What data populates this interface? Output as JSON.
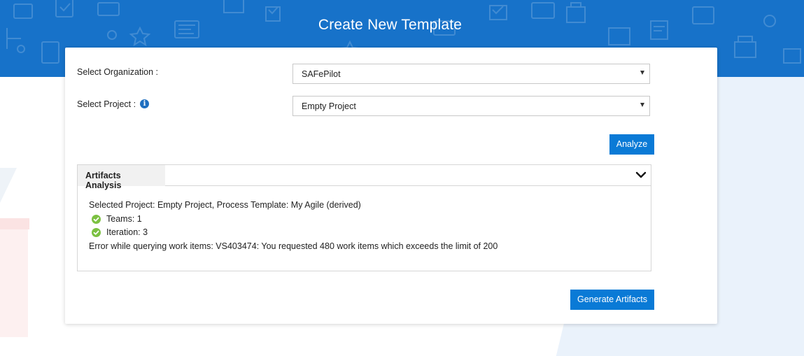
{
  "page": {
    "title": "Create New Template"
  },
  "form": {
    "organization_label": "Select Organization :",
    "organization_value": "SAFePilot",
    "project_label": "Select Project :",
    "project_value": "Empty Project",
    "info_icon": "info-icon",
    "analyze_label": "Analyze"
  },
  "analysis": {
    "title": "Artifacts Analysis",
    "summary": "Selected Project: Empty Project,   Process Template: My Agile (derived)",
    "items": [
      {
        "label": "Teams: 1",
        "icon": "check-circle-icon"
      },
      {
        "label": "Iteration: 3",
        "icon": "check-circle-icon"
      }
    ],
    "error": "Error while querying work items: VS403474: You requested 480 work items which exceeds the limit of 200"
  },
  "actions": {
    "generate_label": "Generate Artifacts"
  },
  "colors": {
    "header_blue": "#1772c9",
    "button_blue": "#0a7ad6",
    "check_green": "#7cc142",
    "info_blue": "#1f6fc0"
  }
}
